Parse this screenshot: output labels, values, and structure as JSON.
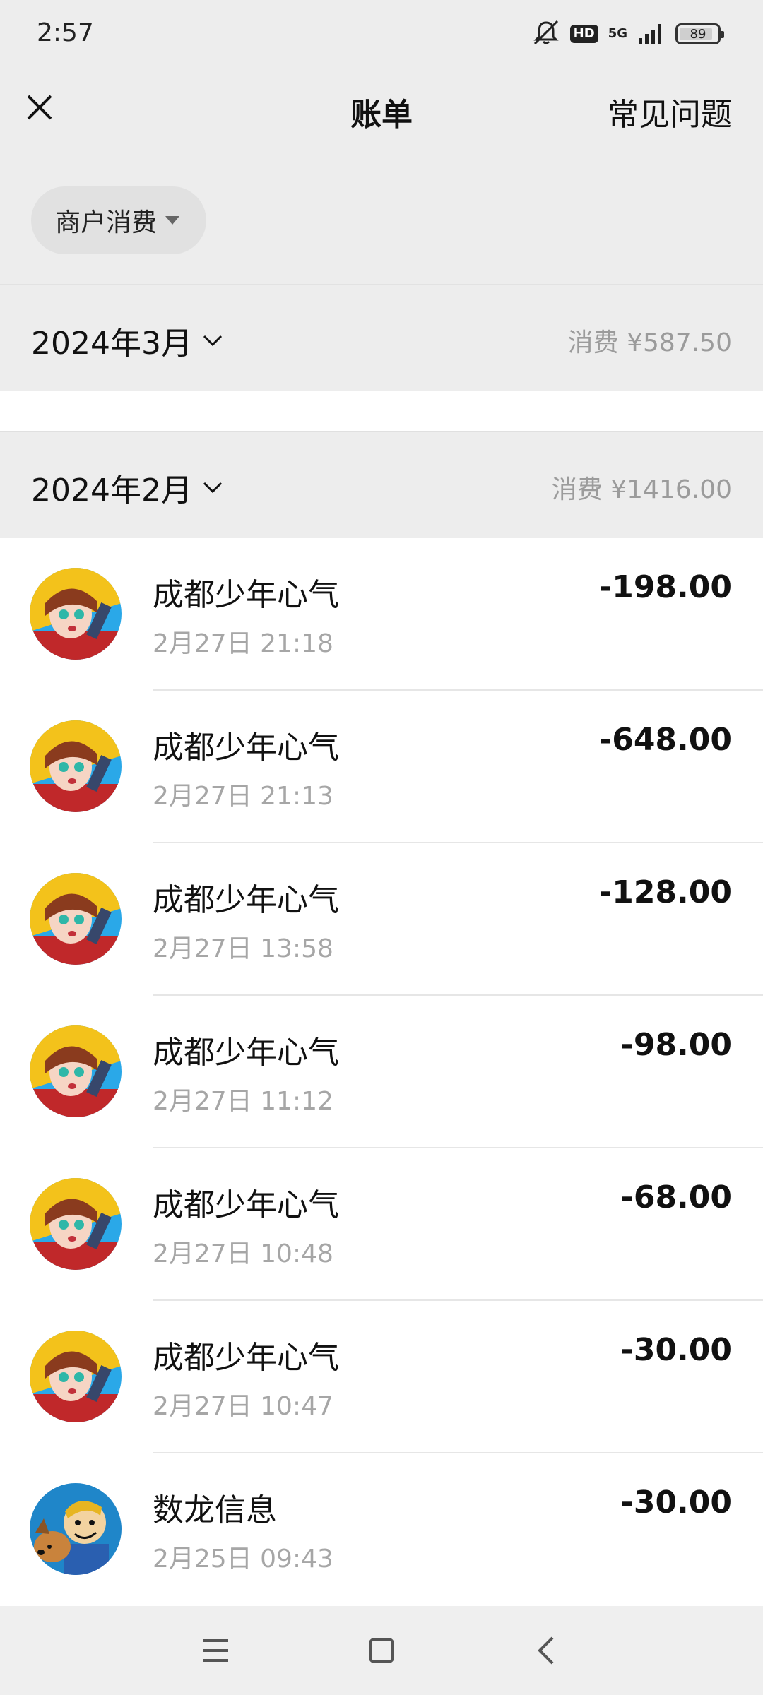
{
  "status_bar": {
    "time": "2:57",
    "hd_label": "HD",
    "network": "5G",
    "battery": "89",
    "battery_level": 0.89
  },
  "header": {
    "title": "账单",
    "right_link": "常见问题"
  },
  "filter": {
    "label": "商户消费"
  },
  "months": [
    {
      "title": "2024年3月",
      "summary": "消费 ¥587.50"
    },
    {
      "title": "2024年2月",
      "summary": "消费 ¥1416.00"
    }
  ],
  "transactions": [
    {
      "merchant": "成都少年心气",
      "datetime": "2月27日 21:18",
      "amount": "-198.00",
      "avatar": "anime-character-avatar"
    },
    {
      "merchant": "成都少年心气",
      "datetime": "2月27日 21:13",
      "amount": "-648.00",
      "avatar": "anime-character-avatar"
    },
    {
      "merchant": "成都少年心气",
      "datetime": "2月27日 13:58",
      "amount": "-128.00",
      "avatar": "anime-character-avatar"
    },
    {
      "merchant": "成都少年心气",
      "datetime": "2月27日 11:12",
      "amount": "-98.00",
      "avatar": "anime-character-avatar"
    },
    {
      "merchant": "成都少年心气",
      "datetime": "2月27日 10:48",
      "amount": "-68.00",
      "avatar": "anime-character-avatar"
    },
    {
      "merchant": "成都少年心气",
      "datetime": "2月27日 10:47",
      "amount": "-30.00",
      "avatar": "anime-character-avatar"
    },
    {
      "merchant": "数龙信息",
      "datetime": "2月25日 09:43",
      "amount": "-30.00",
      "avatar": "cartoon-dog-avatar"
    }
  ],
  "colors": {
    "background": "#ededed",
    "card": "#ffffff",
    "muted_text": "#9b9b9b",
    "primary_text": "#111111"
  },
  "icons": [
    "close-icon",
    "caret-down-icon",
    "chevron-down-icon",
    "menu-icon",
    "home-icon",
    "back-icon",
    "mute-icon",
    "signal-icon",
    "battery-icon"
  ]
}
